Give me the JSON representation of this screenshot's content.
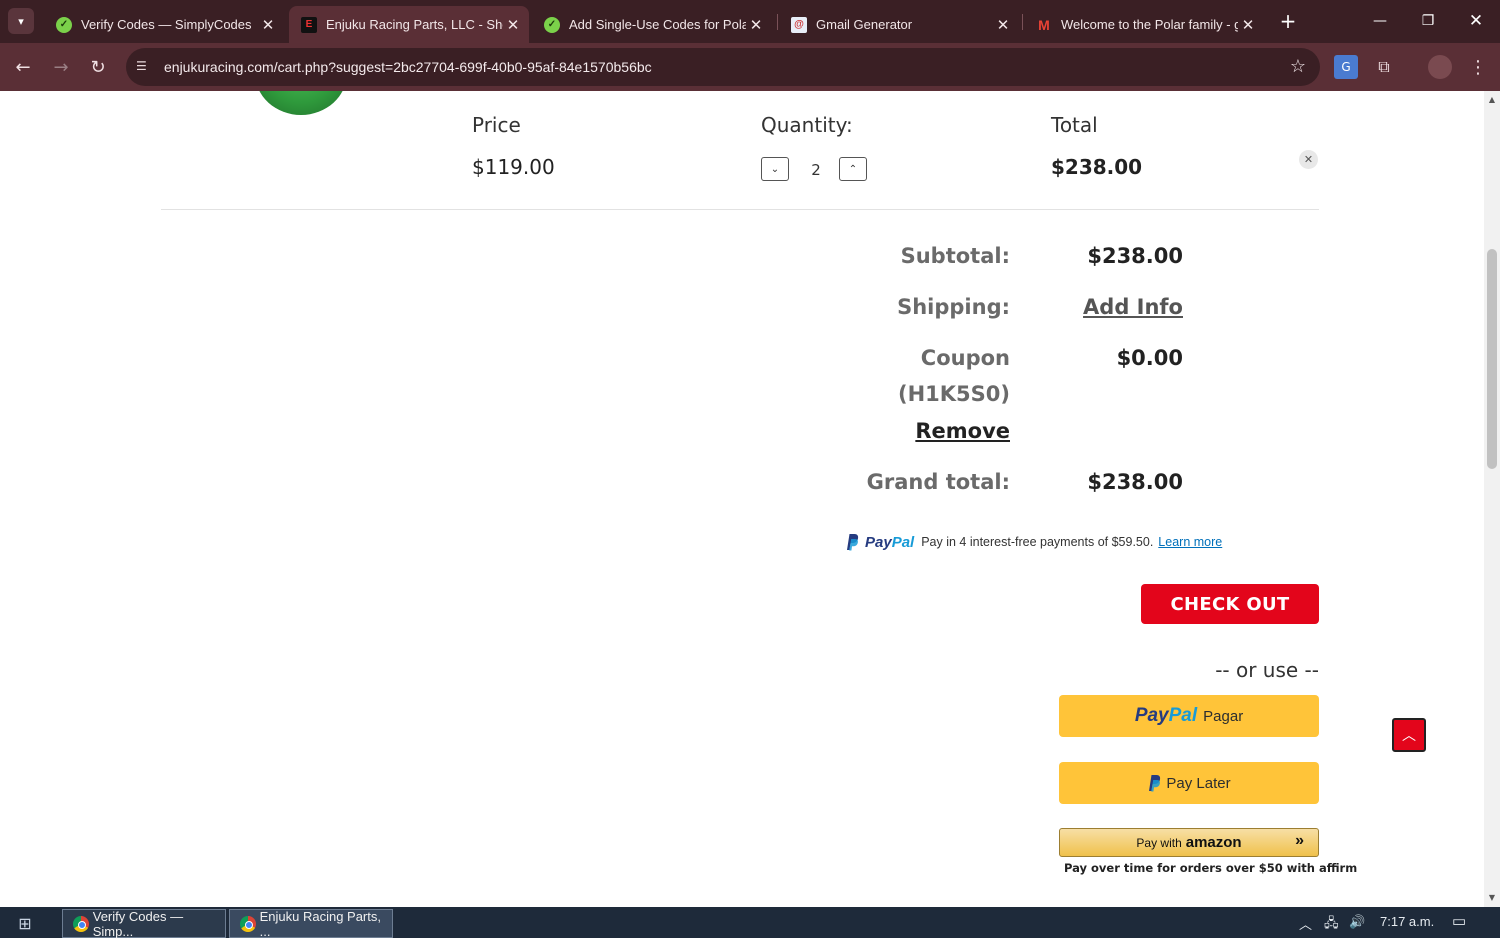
{
  "browser": {
    "tabs": [
      {
        "title": "Verify Codes — SimplyCodes",
        "active": false
      },
      {
        "title": "Enjuku Racing Parts, LLC - Shop",
        "active": true
      },
      {
        "title": "Add Single-Use Codes for Polar",
        "active": false
      },
      {
        "title": "Gmail Generator",
        "active": false
      },
      {
        "title": "Welcome to the Polar family - g",
        "active": false
      }
    ],
    "url": "enjukuracing.com/cart.php?suggest=2bc27704-699f-40b0-95af-84e1570b56bc"
  },
  "cart": {
    "price_label": "Price",
    "price_value": "$119.00",
    "quantity_label": "Quantity:",
    "quantity_value": "2",
    "total_label": "Total",
    "total_value": "$238.00"
  },
  "summary": {
    "subtotal_label": "Subtotal:",
    "subtotal_value": "$238.00",
    "shipping_label": "Shipping:",
    "shipping_value": "Add Info",
    "coupon_label_line1": "Coupon",
    "coupon_label_line2": "(H1K5S0)",
    "coupon_value": "$0.00",
    "coupon_remove": "Remove",
    "grand_total_label": "Grand total:",
    "grand_total_value": "$238.00"
  },
  "paypal_message": {
    "brand_pay": "Pay",
    "brand_pal": "Pal",
    "text": "Pay in 4 interest-free payments of $59.50.",
    "link": "Learn more"
  },
  "checkout": {
    "button": "CHECK OUT",
    "or_use": "-- or use --",
    "paypal_brand_pay": "Pay",
    "paypal_brand_pal": "Pal",
    "paypal_button_text": "Pagar",
    "pay_later_text": "Pay Later",
    "amazon_prefix": "Pay with",
    "amazon_word": "amazon",
    "affirm_text": "Pay over time for orders over $50 with affirm"
  },
  "taskbar": {
    "items": [
      {
        "title": "Verify Codes — Simp..."
      },
      {
        "title": "Enjuku Racing Parts, ..."
      }
    ],
    "time": "7:17 a.m."
  },
  "colors": {
    "checkout_red": "#e3051b",
    "paypal_yellow": "#ffc439",
    "chrome_dark": "#3a1f24"
  }
}
